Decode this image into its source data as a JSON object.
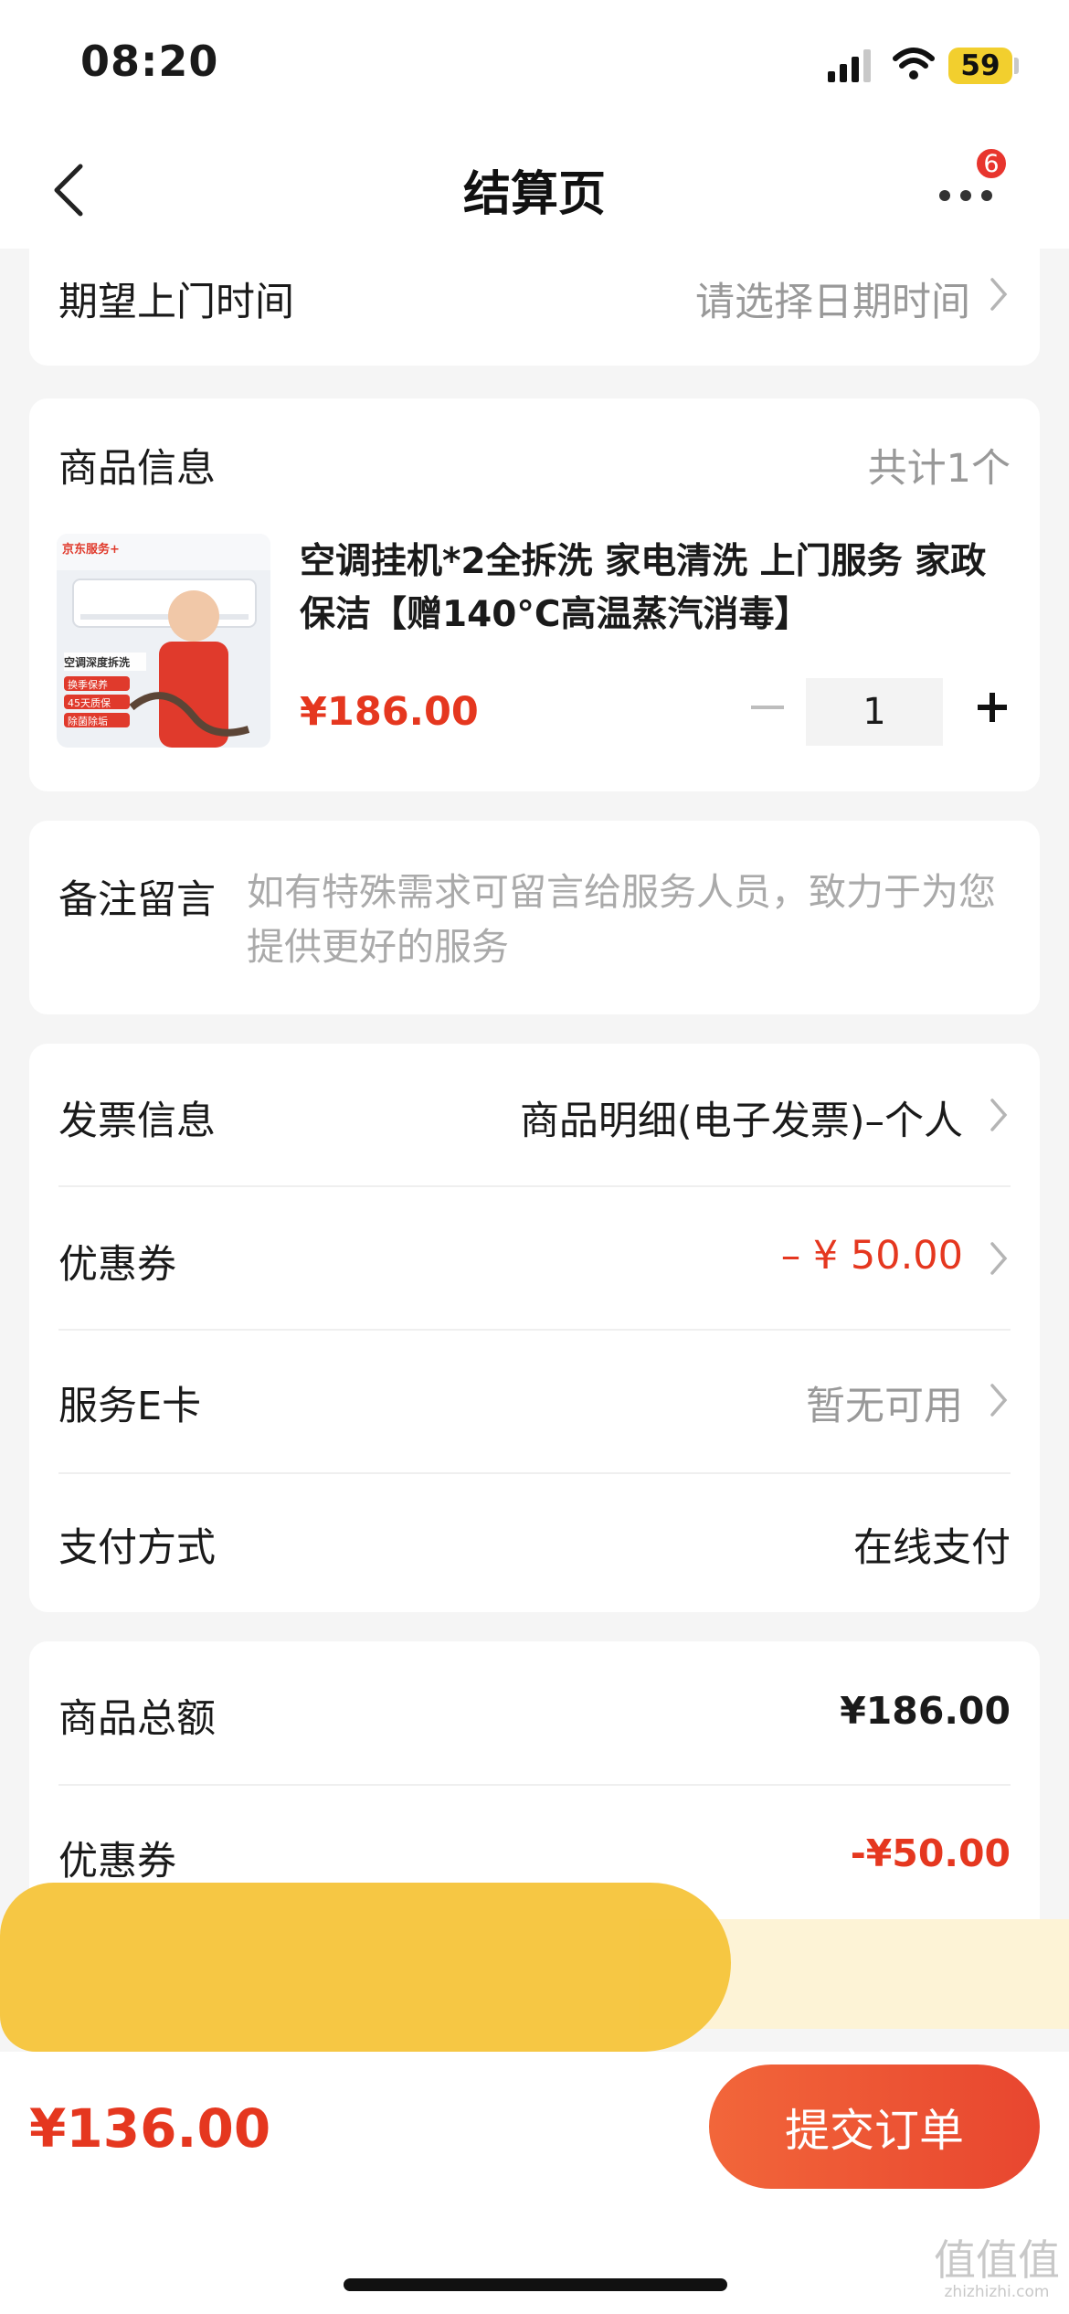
{
  "status_bar": {
    "time": "08:20",
    "battery": "59"
  },
  "nav": {
    "title": "结算页",
    "badge": "6"
  },
  "visit_time": {
    "label": "期望上门时间",
    "placeholder": "请选择日期时间"
  },
  "product": {
    "section_label": "商品信息",
    "count_text": "共计1个",
    "title": "空调挂机*2全拆洗 家电清洗 上门服务 家政保洁【赠140°C高温蒸汽消毒】",
    "price": "¥186.00",
    "quantity": "1",
    "image_text": {
      "brand": "京东服务+",
      "headline": "空调深度拆洗",
      "tags": [
        "换季保养",
        "45天质保",
        "除菌除垢"
      ]
    }
  },
  "remark": {
    "label": "备注留言",
    "placeholder": "如有特殊需求可留言给服务人员，致力于为您提供更好的服务"
  },
  "options": {
    "invoice": {
      "label": "发票信息",
      "value": "商品明细(电子发票)–个人"
    },
    "coupon": {
      "label": "优惠券",
      "value": "– ¥ 50.00"
    },
    "ecard": {
      "label": "服务E卡",
      "value": "暂无可用"
    },
    "payment": {
      "label": "支付方式",
      "value": "在线支付"
    }
  },
  "summary": {
    "goods_total_label": "商品总额",
    "goods_total_value": "¥186.00",
    "coupon_label": "优惠券",
    "coupon_value": "-¥50.00"
  },
  "bottom": {
    "total": "¥136.00",
    "submit_label": "提交订单"
  },
  "watermark": {
    "main": "值值值",
    "sub": "zhizhizhi.com"
  },
  "colors": {
    "accent": "#e5371f",
    "button_start": "#f2663a",
    "button_end": "#e8462f",
    "background": "#f5f5f5"
  }
}
